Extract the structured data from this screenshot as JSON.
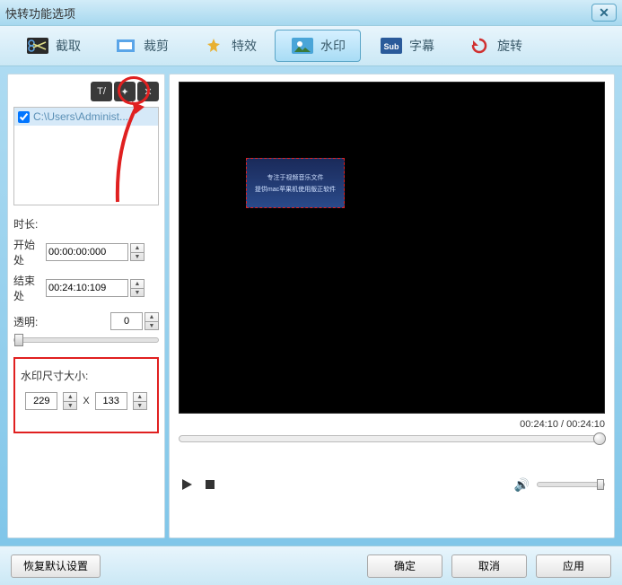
{
  "window": {
    "title": "快转功能选项"
  },
  "tabs": {
    "crop": "截取",
    "trim": "裁剪",
    "effect": "特效",
    "watermark": "水印",
    "subtitle": "字幕",
    "rotate": "旋转"
  },
  "files": {
    "item1_path": "C:\\Users\\Administ..."
  },
  "duration": {
    "label": "时长:",
    "start_label": "开始处",
    "end_label": "结束处",
    "start_value": "00:00:00:000",
    "end_value": "00:24:10:109"
  },
  "opacity": {
    "label": "透明:",
    "value": "0"
  },
  "watermark_size": {
    "label": "水印尺寸大小:",
    "width": "229",
    "height": "133",
    "sep": "X"
  },
  "preview": {
    "wm_line1": "专注于视频音乐文件",
    "wm_line2": "提供mac苹果机使用版正软件",
    "time_current": "00:24:10",
    "time_total": "00:24:10"
  },
  "footer": {
    "restore_default": "恢复默认设置",
    "ok": "确定",
    "cancel": "取消",
    "apply": "应用"
  }
}
